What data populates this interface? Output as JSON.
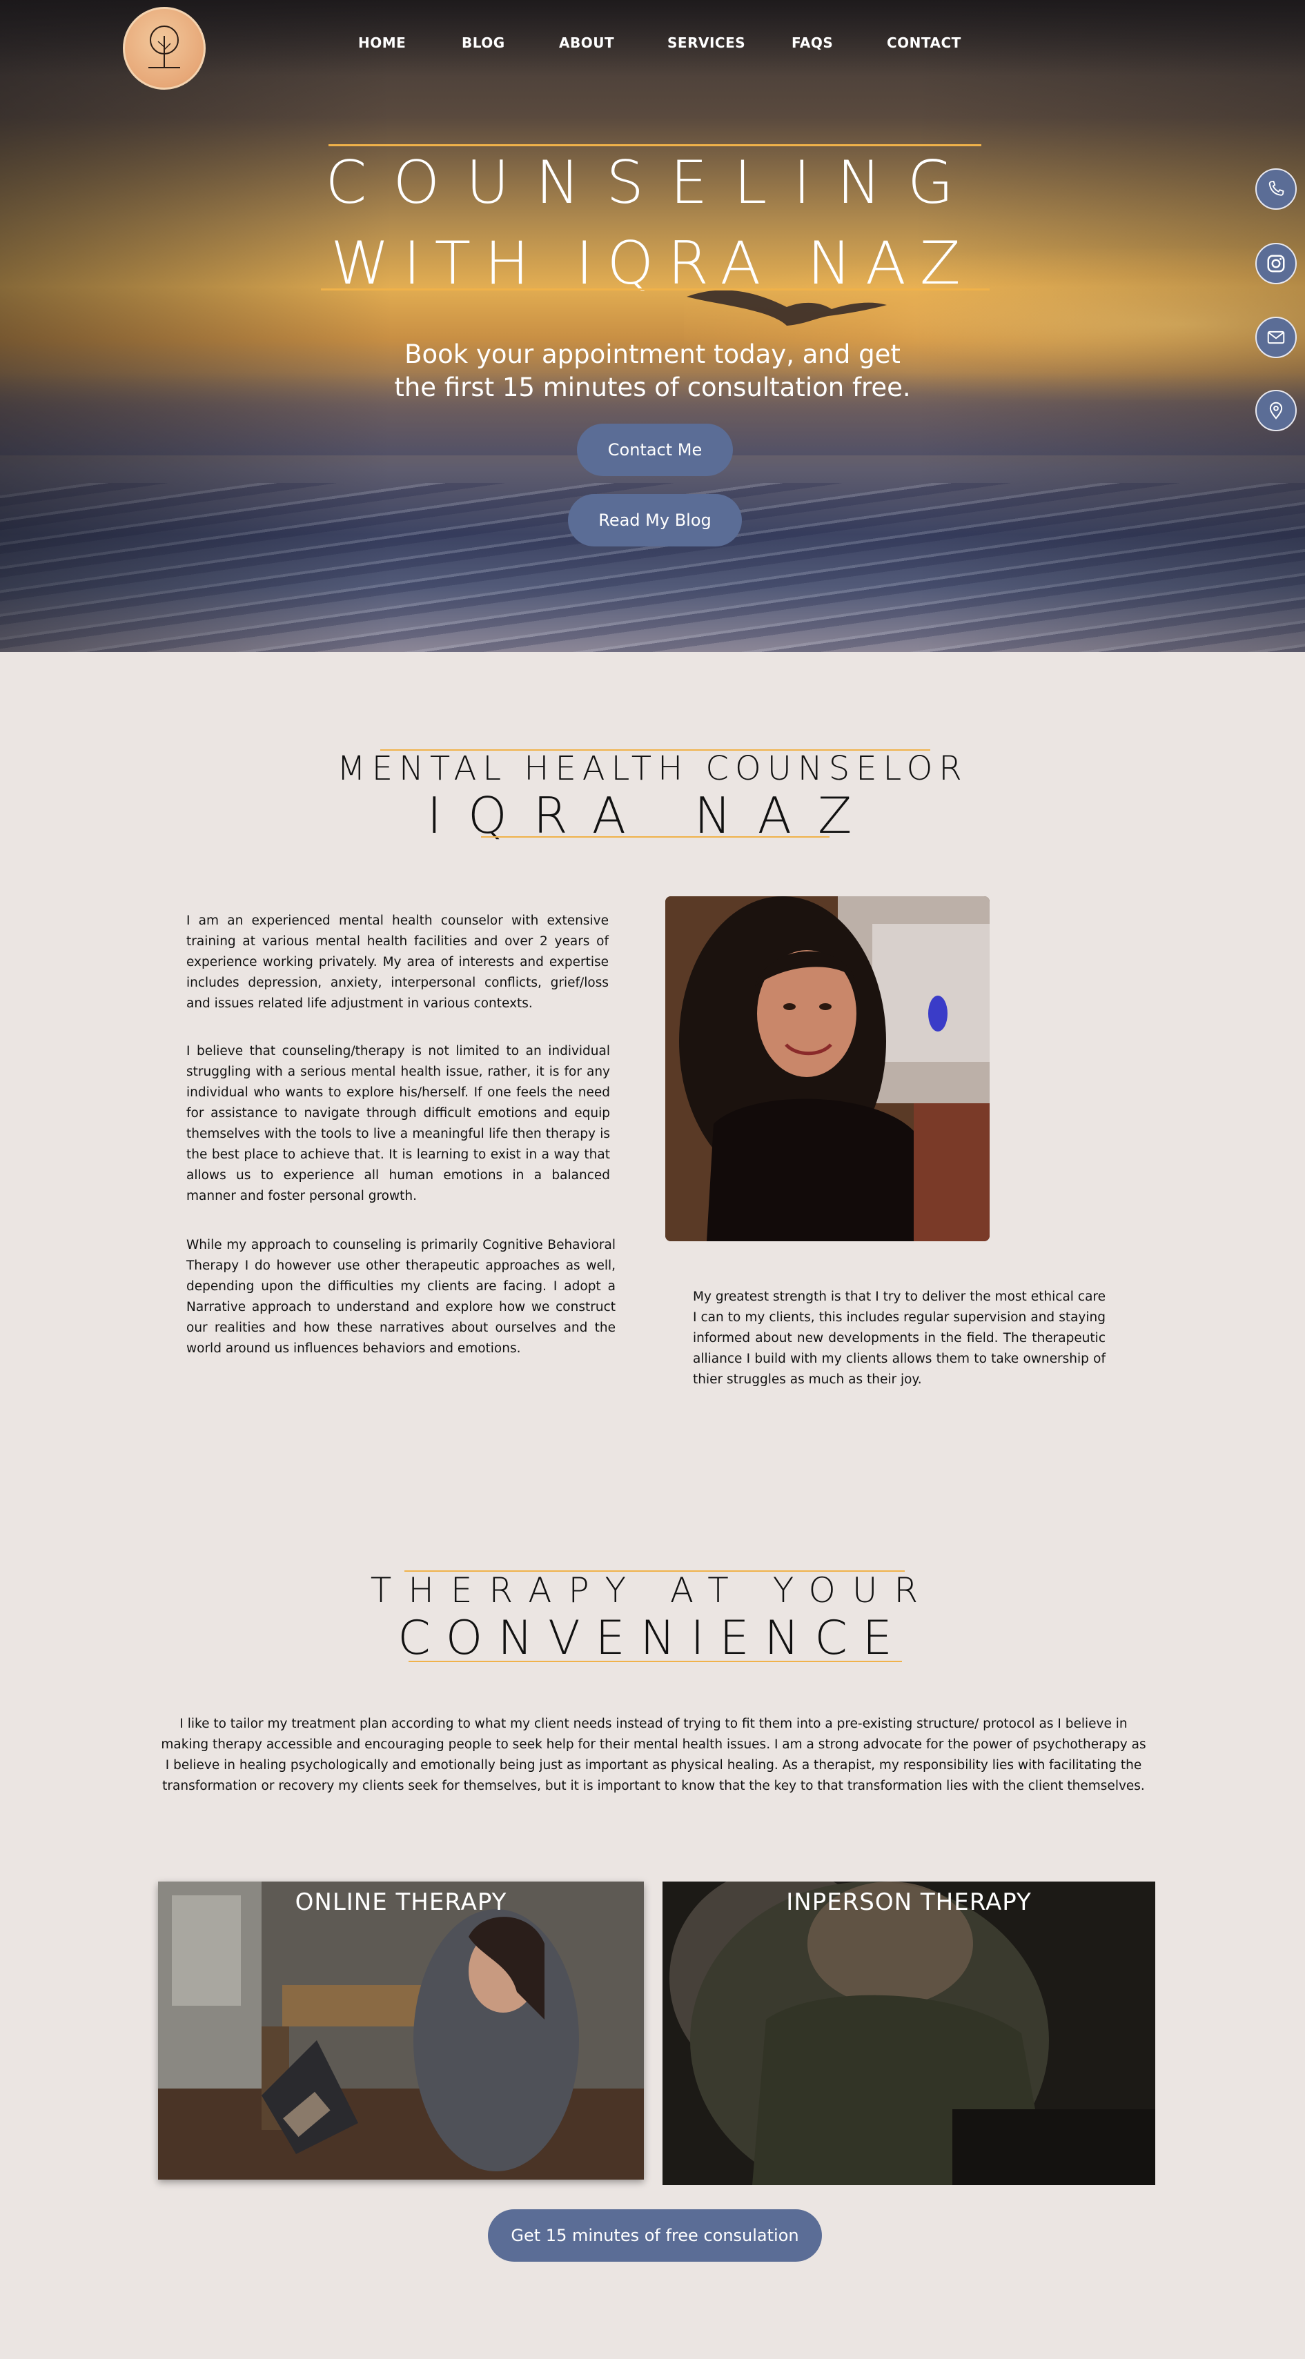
{
  "nav": {
    "items": [
      {
        "label": "HOME"
      },
      {
        "label": "BLOG"
      },
      {
        "label": "ABOUT"
      },
      {
        "label": "SERVICES"
      },
      {
        "label": "FAQS"
      },
      {
        "label": "CONTACT"
      }
    ]
  },
  "hero": {
    "title_line1": "COUNSELING",
    "title_line2": "WITH IQRA NAZ",
    "subtitle_line1": "Book your appointment today, and get",
    "subtitle_line2": "the first 15 minutes of consultation free.",
    "contact_button": "Contact Me",
    "blog_button": "Read My Blog"
  },
  "social": {
    "icons": [
      "phone-icon",
      "instagram-icon",
      "mail-icon",
      "location-icon"
    ]
  },
  "about": {
    "heading_small": "MENTAL HEALTH COUNSELOR",
    "heading_large": "IQRA NAZ",
    "para1": "I am an experienced mental health counselor with extensive training at various mental health facilities and over 2 years of experience working privately. My area of interests and expertise includes depression, anxiety, interpersonal conflicts, grief/loss and issues related life adjustment in various contexts.",
    "para2": "I believe that counseling/therapy is not limited to an individual struggling with a serious mental health issue, rather, it is for any individual who wants to explore his/herself. If one feels the need for assistance to navigate through difficult emotions and equip themselves with the tools to live a meaningful life then therapy is the best place to achieve that. It is learning to exist in a way that allows us to experience all human emotions in a balanced manner and foster personal growth.",
    "para3": "While my approach to counseling is primarily Cognitive Behavioral Therapy I do however use other therapeutic approaches as well, depending upon the difficulties my clients are facing. I adopt a Narrative approach to understand and explore how we construct our realities and how these narratives about ourselves and the world around us influences behaviors and emotions.",
    "para4": "My greatest strength is that I try to deliver the most ethical care I can to my clients, this includes regular supervision and staying informed about new developments in the field. The therapeutic alliance I build with my clients allows them to take ownership of thier struggles as much as their joy."
  },
  "therapy": {
    "heading_line1": "THERAPY AT YOUR",
    "heading_line2": "CONVENIENCE",
    "text": "I like to tailor my treatment plan according to what my client needs instead of trying to fit them into a pre-existing structure/ protocol as I believe in making therapy accessible and encouraging people to seek help for their mental health issues. I am a strong advocate for the power of psychotherapy as I believe in healing psychologically and emotionally being just as important as physical healing. As a therapist, my responsibility lies with facilitating the transformation or recovery my clients seek for themselves, but it is important to know that the key to that transformation lies with the client themselves.",
    "card_online": "ONLINE THERAPY",
    "card_inperson": "INPERSON THERAPY",
    "consult_button": "Get 15 minutes of free consulation"
  },
  "colors": {
    "accent_gold": "#f0b24a",
    "button_blue": "#5b6d96",
    "page_background": "#ebe5e2"
  }
}
